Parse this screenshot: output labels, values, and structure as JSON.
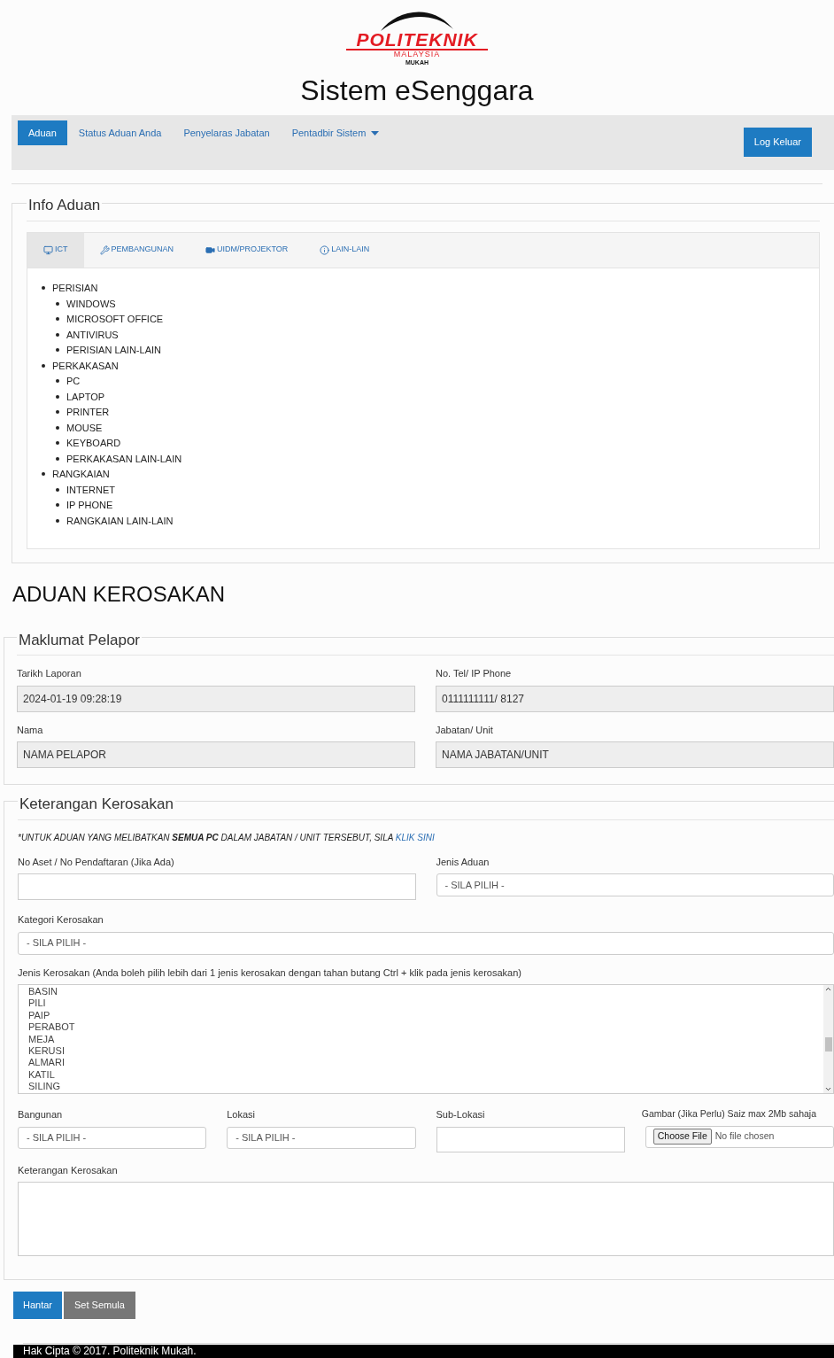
{
  "logo": {
    "name": "POLITEKNIK",
    "country": "MALAYSIA",
    "campus": "MUKAH"
  },
  "title": "Sistem eSenggara",
  "nav": {
    "items": [
      {
        "label": "Aduan",
        "selected": true,
        "dropdown": false
      },
      {
        "label": "Status Aduan Anda",
        "selected": false,
        "dropdown": false
      },
      {
        "label": "Penyelaras Jabatan",
        "selected": false,
        "dropdown": false
      },
      {
        "label": "Pentadbir Sistem",
        "selected": false,
        "dropdown": true
      }
    ],
    "logout": "Log Keluar"
  },
  "info": {
    "legend": "Info Aduan",
    "tabs": [
      {
        "label": "ICT",
        "kind": "monitor",
        "selected": true
      },
      {
        "label": "PEMBANGUNAN",
        "kind": "tools",
        "selected": false
      },
      {
        "label": "UIDM/PROJEKTOR",
        "kind": "video",
        "selected": false
      },
      {
        "label": "LAIN-LAIN",
        "kind": "info",
        "selected": false
      }
    ],
    "tree": [
      {
        "label": "PERISIAN",
        "children": [
          {
            "label": "WINDOWS"
          },
          {
            "label": "MICROSOFT OFFICE"
          },
          {
            "label": "ANTIVIRUS"
          },
          {
            "label": "PERISIAN LAIN-LAIN"
          }
        ]
      },
      {
        "label": "PERKAKASAN",
        "children": [
          {
            "label": "PC"
          },
          {
            "label": "LAPTOP"
          },
          {
            "label": "PRINTER"
          },
          {
            "label": "MOUSE"
          },
          {
            "label": "KEYBOARD"
          },
          {
            "label": "PERKAKASAN LAIN-LAIN"
          }
        ]
      },
      {
        "label": "RANGKAIAN",
        "children": [
          {
            "label": "INTERNET"
          },
          {
            "label": "IP PHONE"
          },
          {
            "label": "RANGKAIAN LAIN-LAIN"
          }
        ]
      }
    ]
  },
  "heading": "ADUAN KEROSAKAN",
  "reporter": {
    "legend": "Maklumat Pelapor",
    "fields": [
      {
        "label": "Tarikh Laporan",
        "value": "2024-01-19 09:28:19"
      },
      {
        "label": "No. Tel/ IP Phone",
        "value": "0111111111/ 8127"
      },
      {
        "label": "Nama",
        "value": "NAMA PELAPOR"
      },
      {
        "label": "Jabatan/ Unit",
        "value": "NAMA JABATAN/UNIT"
      }
    ]
  },
  "details": {
    "legend": "Keterangan Kerosakan",
    "notice_start": "*UNTUK ADUAN YANG MELIBATKAN",
    "notice_bold": "SEMUA PC",
    "notice_end": "DALAM JABATAN / UNIT TERSEBUT, SILA",
    "notice_link": "KLIK SINI",
    "asset_label": "No Aset / No Pendaftaran (Jika Ada)",
    "type_label": "Jenis Aduan",
    "type_value": "- SILA PILIH -",
    "category_label": "Kategori Kerosakan",
    "category_value": "- SILA PILIH -",
    "damage_label": "Jenis Kerosakan (Anda boleh pilih lebih dari 1 jenis kerosakan dengan tahan butang Ctrl + klik pada jenis kerosakan)",
    "damage_options": [
      "BASIN",
      "PILI",
      "PAIP",
      "PERABOT",
      "MEJA",
      "KERUSI",
      "ALMARI",
      "KATIL",
      "SILING"
    ],
    "building_label": "Bangunan",
    "building_value": "- SILA PILIH -",
    "location_label": "Lokasi",
    "location_value": "- SILA PILIH -",
    "sublocation_label": "Sub-Lokasi",
    "image_label": "Gambar (Jika Perlu) Saiz max 2Mb sahaja",
    "file_button": "Choose File",
    "file_status": "No file chosen",
    "description_label": "Keterangan Kerosakan"
  },
  "buttons": {
    "submit": "Hantar",
    "reset": "Set Semula"
  },
  "footer": "Hak Cipta © 2017. Politeknik Mukah."
}
